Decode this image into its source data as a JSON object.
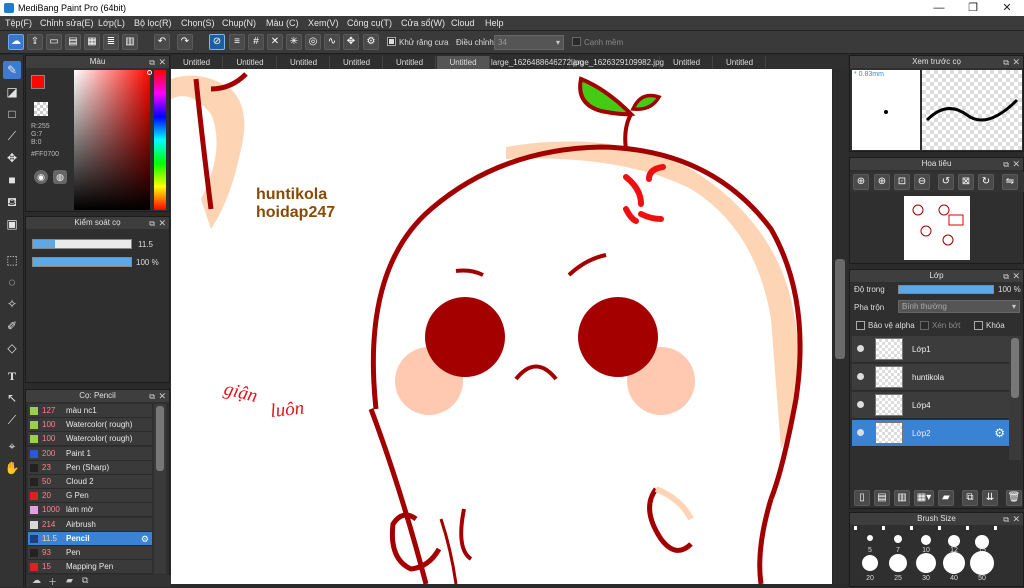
{
  "window": {
    "title": "MediBang Paint Pro (64bit)",
    "minimize": "—",
    "maximize": "❐",
    "close": "✕"
  },
  "menu": [
    "Tệp(F)",
    "Chỉnh sửa(E)",
    "Lớp(L)",
    "Bộ lọc(R)",
    "Chọn(S)",
    "Chụp(N)",
    "Màu (C)",
    "Xem(V)",
    "Công cụ(T)",
    "Cửa sổ(W)",
    "Cloud",
    "Help"
  ],
  "toolbar": {
    "antialias_label": "Khử răng cưa",
    "adjust_label": "Điều chỉnh",
    "adjust_value": "34",
    "smooth_label": "Cạnh mềm",
    "antialias_checked": true,
    "smooth_checked": false
  },
  "tabs": [
    "Untitled",
    "Untitled",
    "Untitled",
    "Untitled",
    "Untitled",
    "Untitled",
    "large_1626488646272.jpg",
    "large_1626329109982.jpg",
    "Untitled",
    "Untitled"
  ],
  "active_tab_index": 5,
  "color_panel": {
    "title": "Màu",
    "r": "R:255",
    "g": "G:7",
    "b": "B:0",
    "hex": "#FF0700",
    "primary_color": "#ff0700",
    "secondary_color": "#ffffff"
  },
  "brush_control": {
    "title": "Kiểm soát cọ",
    "size_value": "11.5",
    "opacity_value": "100 %",
    "size_fraction": 0.22,
    "opacity_fraction": 1.0
  },
  "brush_panel": {
    "title": "Cọ: Pencil",
    "items": [
      {
        "size": "127",
        "name": "màu nc1",
        "color": "#9ccf4b"
      },
      {
        "size": "100",
        "name": "Watercolor( rough)",
        "color": "#9ccf4b"
      },
      {
        "size": "100",
        "name": "Watercolor( rough)",
        "color": "#9ccf4b"
      },
      {
        "size": "200",
        "name": "Paint 1",
        "color": "#2b59d6"
      },
      {
        "size": "23",
        "name": "Pen (Sharp)",
        "color": "#222222"
      },
      {
        "size": "50",
        "name": "Cloud 2",
        "color": "#222222"
      },
      {
        "size": "20",
        "name": "G Pen",
        "color": "#e02020"
      },
      {
        "size": "1000",
        "name": "làm mờ",
        "color": "#e2a0e0"
      },
      {
        "size": "214",
        "name": "Airbrush",
        "color": "#d8d8d8"
      },
      {
        "size": "11.5",
        "name": "Pencil",
        "color": "#1f3f7a"
      },
      {
        "size": "93",
        "name": "Pen",
        "color": "#222222"
      },
      {
        "size": "15",
        "name": "Mapping Pen",
        "color": "#e02020"
      }
    ],
    "selected_index": 9
  },
  "canvas": {
    "text1": "huntikola",
    "text2": "hoidap247",
    "handwriting1": "giận",
    "handwriting2": "luôn"
  },
  "preview_panel": {
    "title": "Xem trước cọ",
    "size": "0.83mm"
  },
  "navigator_panel": {
    "title": "Hoa tiêu"
  },
  "layer_panel": {
    "title": "Lớp",
    "opacity_label": "Độ trong",
    "opacity_value": "100 %",
    "opacity_fraction": 1.0,
    "blend_label": "Pha trộn",
    "blend_value": "Bình thường",
    "protect_alpha": "Bảo vệ alpha",
    "clipping": "Xén bớt",
    "lock": "Khóa",
    "layers": [
      {
        "name": "Lớp1",
        "selected": false
      },
      {
        "name": "huntikola",
        "selected": false
      },
      {
        "name": "Lớp4",
        "selected": false
      },
      {
        "name": "Lớp2",
        "selected": true
      }
    ]
  },
  "brush_size_panel": {
    "title": "Brush Size",
    "row1": [
      "5",
      "7",
      "10",
      "12",
      "15"
    ],
    "row2": [
      "20",
      "25",
      "30",
      "40",
      "50"
    ]
  }
}
